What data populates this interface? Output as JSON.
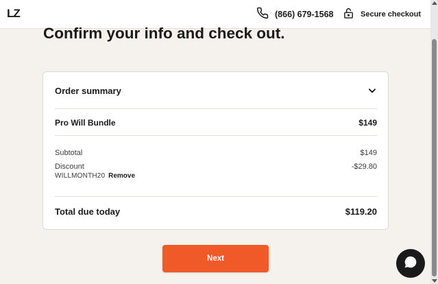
{
  "header": {
    "logo_text": "LZ",
    "phone_number": "(866) 679-1568",
    "secure_label": "Secure checkout"
  },
  "page": {
    "title": "Confirm your info and check out."
  },
  "order_summary": {
    "title": "Order summary",
    "item_name": "Pro Will Bundle",
    "item_price": "$149",
    "subtotal_label": "Subtotal",
    "subtotal_value": "$149",
    "discount_label": "Discount",
    "discount_value": "-$29.80",
    "promo_code": "WILLMONTH20",
    "remove_label": "Remove",
    "total_label": "Total due today",
    "total_value": "$119.20"
  },
  "actions": {
    "next_label": "Next"
  },
  "icons": {
    "phone": "phone-icon",
    "lock": "lock-icon",
    "chevron": "chevron-down-icon",
    "chat": "chat-bubble-icon"
  },
  "colors": {
    "accent": "#f05a28",
    "background": "#f5f1ec",
    "chat_button": "#1a1a1a"
  }
}
